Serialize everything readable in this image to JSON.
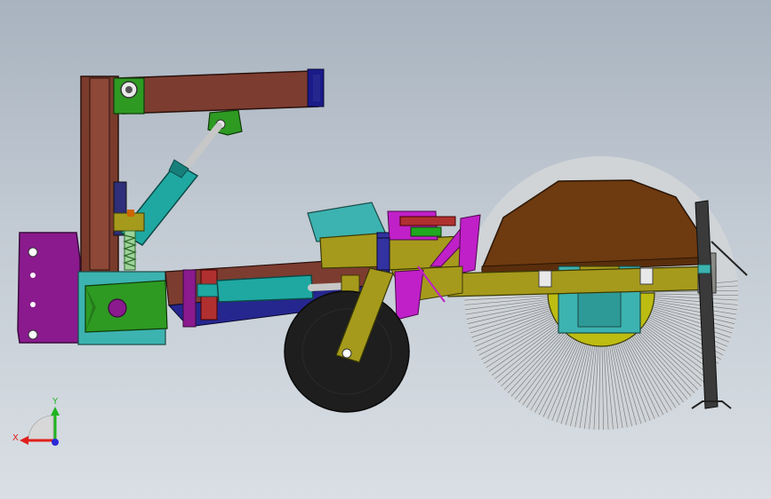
{
  "viewport": {
    "background_top": "#a8b3bf",
    "background_bottom": "#d9dfe4"
  },
  "triad": {
    "x_label": "X",
    "y_label": "Y",
    "x_color": "#e0201a",
    "y_color": "#1fb41f",
    "z_color": "#2a2ad8"
  },
  "colors": {
    "frame_brown": "#7a3b2c",
    "arm_brown": "#7d3c30",
    "bracket_green": "#2e9a22",
    "cylinder_teal": "#1fa8a2",
    "mount_purple": "#8a1a8e",
    "chassis_olive": "#a69a1c",
    "wheel_black": "#1e1e1e",
    "brush_hood": "#6e3a10",
    "magenta": "#c020c8"
  },
  "parts": [
    "vertical-mast",
    "lift-arm",
    "hydraulic-cylinder-upper",
    "hydraulic-cylinder-lower",
    "mounting-plate",
    "support-wheel",
    "chassis-frame",
    "sweeper-brush",
    "brush-hood",
    "stand-leg"
  ]
}
